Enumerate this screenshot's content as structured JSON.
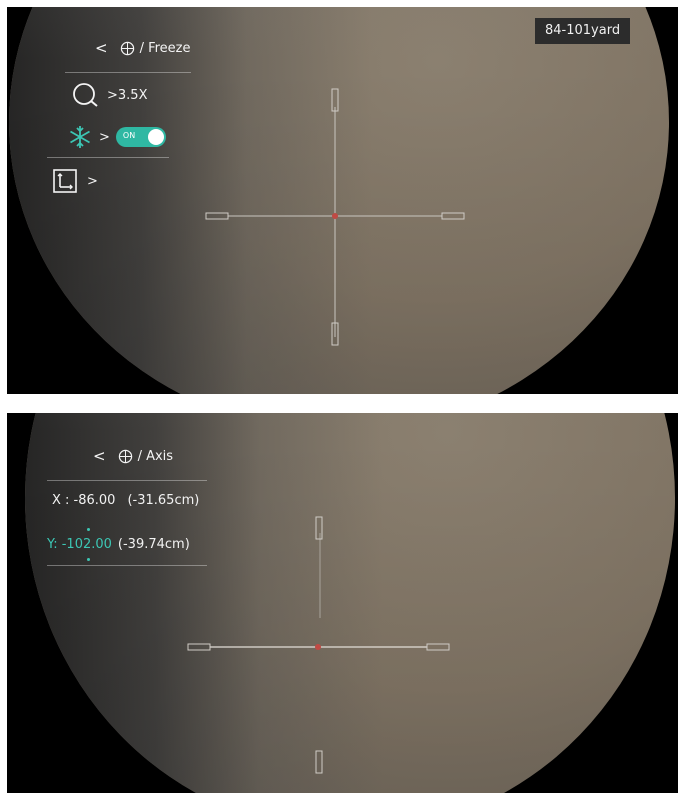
{
  "top_panel": {
    "range_badge": "84-101yard",
    "breadcrumb": {
      "back": "<",
      "path": "/ Freeze"
    },
    "zoom": {
      "arrow": ">",
      "value": "3.5X"
    },
    "freeze": {
      "arrow": ">",
      "toggle_label": "ON",
      "state": "on"
    },
    "axis": {
      "arrow": ">"
    }
  },
  "bottom_panel": {
    "breadcrumb": {
      "back": "<",
      "path": "/ Axis"
    },
    "x": {
      "label": "X : -86.00",
      "cm": "(-31.65cm)"
    },
    "y": {
      "label": "Y: -102.00",
      "cm": "(-39.74cm)"
    }
  },
  "colors": {
    "accent": "#3cc6b4",
    "center_dot": "#c04a44",
    "text": "#f4f4f4"
  },
  "icons": {
    "back": "chevron-left-icon",
    "reticle": "crosshair-circle-icon",
    "zoom": "magnifier-icon",
    "freeze": "snowflake-icon",
    "axis": "axis-adjust-icon"
  }
}
